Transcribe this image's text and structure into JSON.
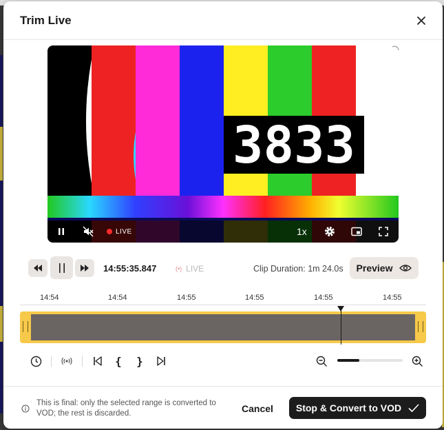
{
  "dialog": {
    "title": "Trim Live"
  },
  "player": {
    "live_label": "LIVE",
    "speed_label": "1x",
    "clock_display": "3833"
  },
  "controls": {
    "timecode": "14:55:35.847",
    "live_label": "LIVE",
    "clip_duration": "Clip Duration: 1m 24.0s",
    "preview_label": "Preview"
  },
  "timeline": {
    "ticks": [
      "14:54",
      "14:54",
      "14:55",
      "14:55",
      "14:55",
      "14:55"
    ],
    "playhead_fraction": 0.79,
    "zoom_level_fraction": 0.34
  },
  "footer": {
    "note": "This is final: only the selected range is converted to VOD; the rest is discarded.",
    "cancel_label": "Cancel",
    "convert_label": "Stop & Convert to VOD"
  },
  "colors": {
    "accent_track": "#f7c94a",
    "primary_button": "#1c1c1c",
    "live_red": "#ff2a2a"
  }
}
